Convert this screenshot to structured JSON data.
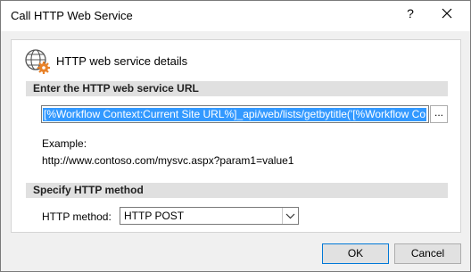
{
  "window": {
    "title": "Call HTTP Web Service",
    "help_label": "?"
  },
  "header": {
    "title": "HTTP web service details",
    "icon": "globe-gear-icon"
  },
  "url_section": {
    "heading": "Enter the HTTP web service URL",
    "url_value": "[%Workflow Context:Current Site URL%]_api/web/lists/getbytitle('[%Workflow Co",
    "browse_label": "...",
    "example_label": "Example:",
    "example_url": "http://www.contoso.com/mysvc.aspx?param1=value1"
  },
  "method_section": {
    "heading": "Specify HTTP method",
    "label": "HTTP method:",
    "selected": "HTTP POST"
  },
  "buttons": {
    "ok": "OK",
    "cancel": "Cancel"
  },
  "colors": {
    "selection": "#3399ff",
    "section_bar": "#e0e0e0",
    "default_button_border": "#0078d7"
  }
}
